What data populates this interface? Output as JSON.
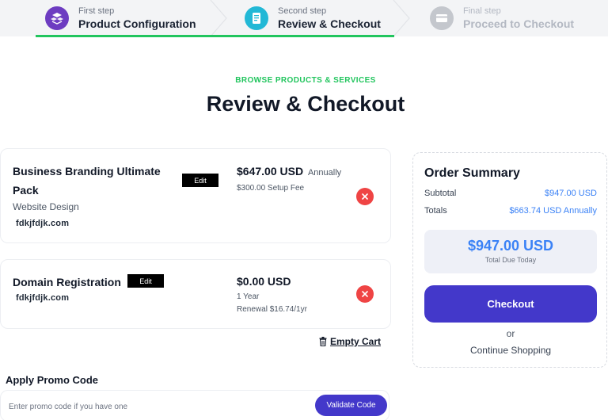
{
  "colors": {
    "accent_green": "#22c55e",
    "primary": "#4338ca",
    "price_blue": "#3b82f6",
    "remove_red": "#ef4444",
    "step1_circle": "#6d3cc1",
    "step2_circle": "#22b8d6",
    "step3_circle": "#c4c7cd"
  },
  "stepper": {
    "steps": [
      {
        "caption": "First step",
        "label": "Product Configuration",
        "icon": "boxes-icon"
      },
      {
        "caption": "Second step",
        "label": "Review & Checkout",
        "icon": "document-icon"
      },
      {
        "caption": "Final step",
        "label": "Proceed to Checkout",
        "icon": "credit-card-icon"
      }
    ]
  },
  "header": {
    "eyebrow": "BROWSE PRODUCTS & SERVICES",
    "title": "Review & Checkout"
  },
  "cart": {
    "items": [
      {
        "name": "Business Branding Ultimate Pack",
        "edit_label": "Edit",
        "group": "Website Design",
        "domain": "fdkjfdjk.com",
        "price": "$647.00 USD",
        "cycle": "Annually",
        "meta": [
          "$300.00 Setup Fee"
        ]
      },
      {
        "name": "Domain Registration",
        "edit_label": "Edit",
        "domain": "fdkjfdjk.com",
        "price": "$0.00 USD",
        "meta": [
          "1 Year",
          "Renewal $16.74/1yr"
        ]
      }
    ],
    "empty_cart_label": "Empty Cart"
  },
  "promo": {
    "label": "Apply Promo Code",
    "placeholder": "Enter promo code if you have one",
    "value": "",
    "button_label": "Validate Code"
  },
  "summary": {
    "title": "Order Summary",
    "subtotal_label": "Subtotal",
    "subtotal_value": "$947.00 USD",
    "totals_label": "Totals",
    "totals_value": "$663.74 USD Annually",
    "due_amount": "$947.00 USD",
    "due_caption": "Total Due Today",
    "checkout_label": "Checkout",
    "or_label": "or",
    "continue_label": "Continue Shopping"
  }
}
